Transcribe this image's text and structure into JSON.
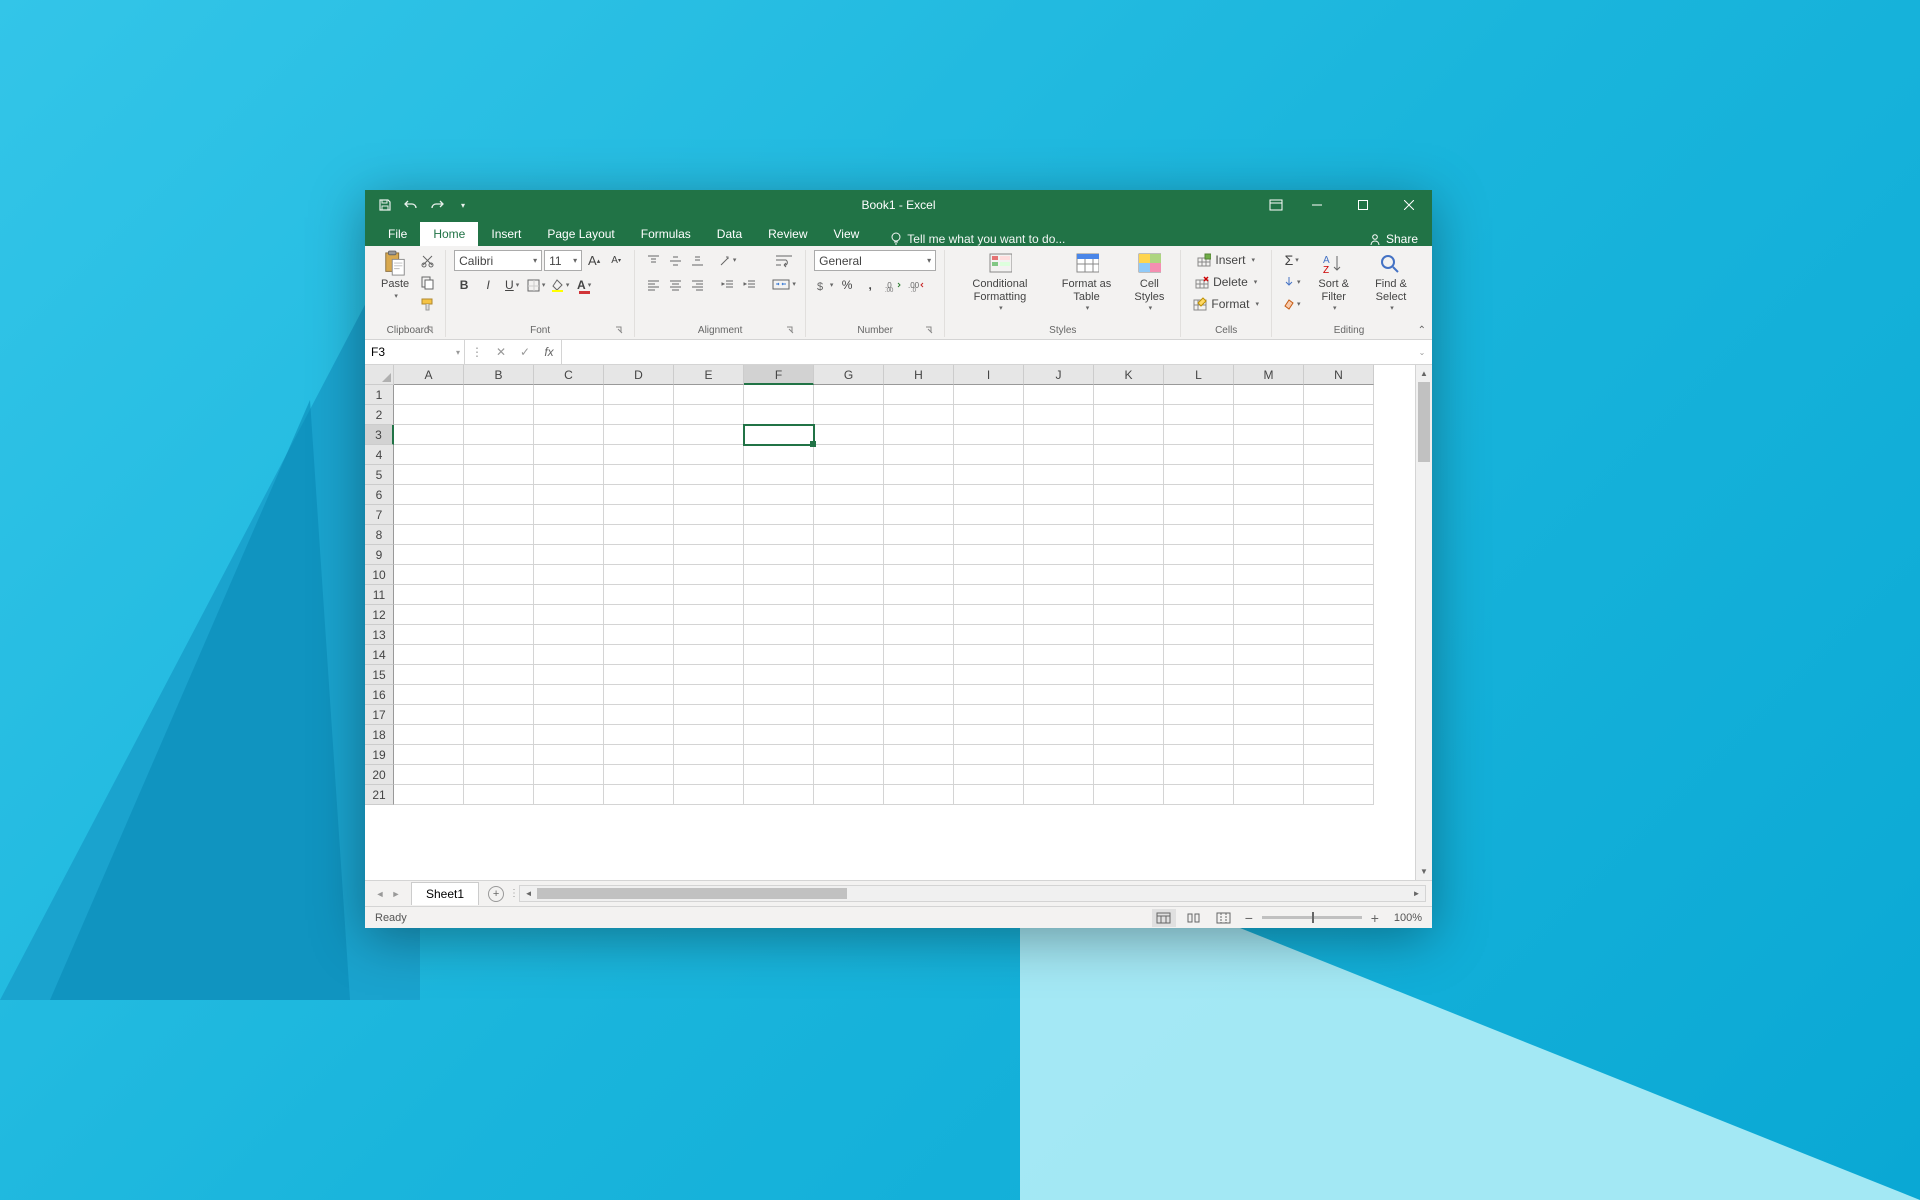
{
  "title": "Book1 - Excel",
  "tabs": {
    "file": "File",
    "home": "Home",
    "insert": "Insert",
    "pageLayout": "Page Layout",
    "formulas": "Formulas",
    "data": "Data",
    "review": "Review",
    "view": "View",
    "tellme": "Tell me what you want to do..."
  },
  "share": "Share",
  "ribbon": {
    "clipboard": {
      "label": "Clipboard",
      "paste": "Paste"
    },
    "font": {
      "label": "Font",
      "name": "Calibri",
      "size": "11"
    },
    "alignment": {
      "label": "Alignment"
    },
    "number": {
      "label": "Number",
      "format": "General"
    },
    "styles": {
      "label": "Styles",
      "cond": "Conditional Formatting",
      "fat": "Format as Table",
      "cell": "Cell Styles"
    },
    "cells": {
      "label": "Cells",
      "insert": "Insert",
      "delete": "Delete",
      "format": "Format"
    },
    "editing": {
      "label": "Editing",
      "sort": "Sort & Filter",
      "find": "Find & Select"
    }
  },
  "namebox": "F3",
  "columns": [
    "A",
    "B",
    "C",
    "D",
    "E",
    "F",
    "G",
    "H",
    "I",
    "J",
    "K",
    "L",
    "M",
    "N"
  ],
  "rows": [
    1,
    2,
    3,
    4,
    5,
    6,
    7,
    8,
    9,
    10,
    11,
    12,
    13,
    14,
    15,
    16,
    17,
    18,
    19,
    20,
    21
  ],
  "selectedCol": "F",
  "selectedRow": 3,
  "sheet": "Sheet1",
  "status": "Ready",
  "zoom": "100%"
}
